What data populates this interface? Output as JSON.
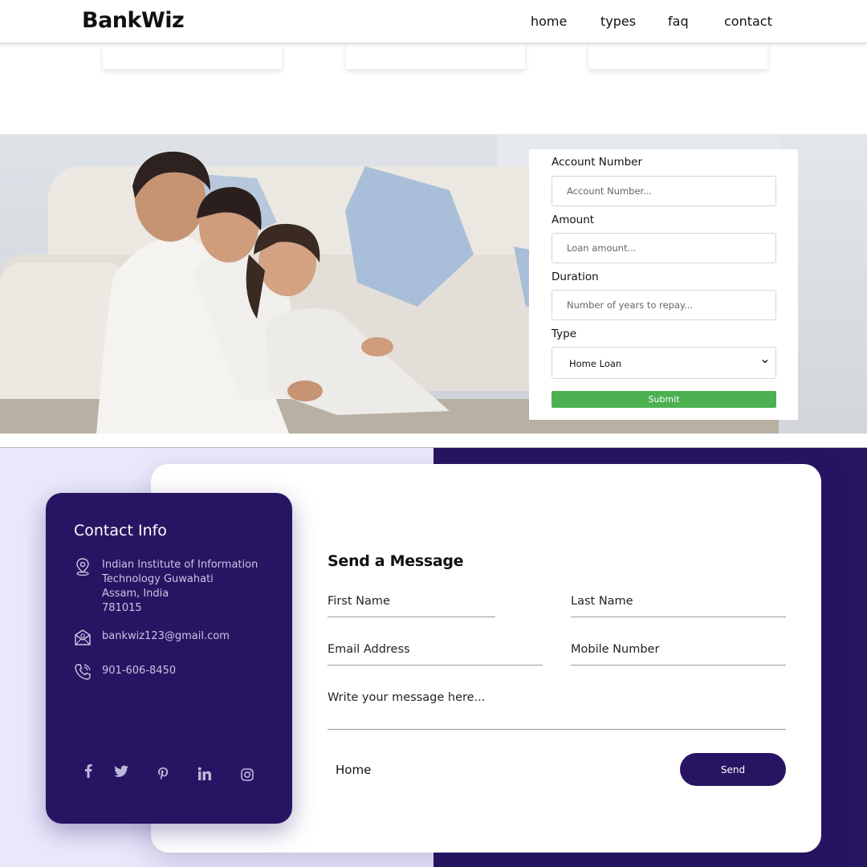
{
  "navbar": {
    "brand": "BankWiz",
    "links": [
      "home",
      "types",
      "faq",
      "contact"
    ]
  },
  "loan_form": {
    "account_label": "Account Number",
    "account_placeholder": "Account Number...",
    "amount_label": "Amount",
    "amount_placeholder": "Loan amount...",
    "duration_label": "Duration",
    "duration_placeholder": "Number of years to repay...",
    "type_label": "Type",
    "type_selected": "Home Loan",
    "submit_label": "Submit"
  },
  "contact_info": {
    "title": "Contact Info",
    "address_lines": [
      "Indian Institute of Information",
      "Technology Guwahati",
      "Assam, India",
      "781015"
    ],
    "email": "bankwiz123@gmail.com",
    "phone": "901-606-8450",
    "social_icons": [
      "facebook-icon",
      "twitter-icon",
      "pinterest-icon",
      "linkedin-icon",
      "instagram-icon"
    ]
  },
  "message_form": {
    "title": "Send a Message",
    "first_name": "First Name",
    "last_name": "Last Name",
    "email": "Email Address",
    "mobile": "Mobile Number",
    "message": "Write your message here...",
    "home_link": "Home",
    "send_label": "Send"
  },
  "colors": {
    "primary": "#271563",
    "submit_green": "#4caf50",
    "lavender": "#e9e8fb"
  }
}
